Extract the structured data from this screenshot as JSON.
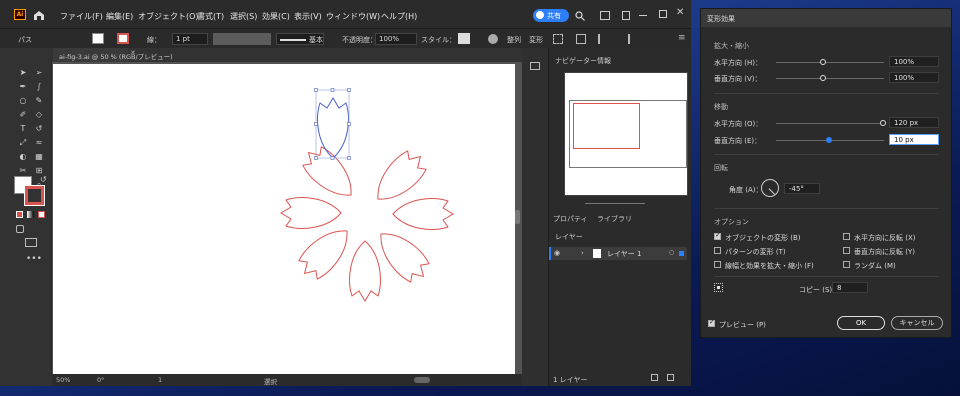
{
  "window": {
    "app_logo": "Ai",
    "doc_tab": "ai-fig-3.ai @ 50 % (RGB/プレビュー)",
    "share_label": "共有"
  },
  "menu": [
    "ファイル(F)",
    "編集(E)",
    "オブジェクト(O)",
    "書式(T)",
    "選択(S)",
    "効果(C)",
    "表示(V)",
    "ウィンドウ(W)",
    "ヘルプ(H)"
  ],
  "control_bar": {
    "object_type": "パス",
    "stroke_label": "線：",
    "stroke_weight": "1 pt",
    "brush_label": "基本",
    "opacity_label": "不透明度：",
    "opacity_value": "100%",
    "style_label": "スタイル：",
    "align_label": "整列",
    "transform_label": "変形"
  },
  "status_bar": {
    "zoom": "50%",
    "rotation": "0°",
    "artboard_num": "1",
    "tool_name": "選択"
  },
  "right_panel": {
    "tab_navigator": "ナビゲーター",
    "tab_info": "情報",
    "tab_properties": "プロパティ",
    "tab_libraries": "ライブラリ",
    "tab_layers": "レイヤー",
    "layer_name": "レイヤー 1",
    "layer_count": "1 レイヤー"
  },
  "dialog": {
    "title": "変形効果",
    "scale_section": "拡大・縮小",
    "scale_h_label": "水平方向 (H)：",
    "scale_h_value": "100%",
    "scale_v_label": "垂直方向 (V)：",
    "scale_v_value": "100%",
    "move_section": "移動",
    "move_h_label": "水平方向 (O)：",
    "move_h_value": "120 px",
    "move_v_label": "垂直方向 (E)：",
    "move_v_value": "10 px",
    "rotate_section": "回転",
    "angle_label": "角度 (A)：",
    "angle_value": "-45°",
    "options_section": "オプション",
    "opt_transform_objects": "オブジェクトの変形 (B)",
    "opt_transform_patterns": "パターンの変形 (T)",
    "opt_scale_strokes": "線幅と効果を拡大・縮小 (F)",
    "opt_reflect_x": "水平方向に反転 (X)",
    "opt_reflect_y": "垂直方向に反転 (Y)",
    "opt_random": "ランダム (M)",
    "copies_label": "コピー (S)",
    "copies_value": "8",
    "preview_label": "プレビュー (P)",
    "ok_label": "OK",
    "cancel_label": "キャンセル",
    "checked": {
      "opt_transform_objects": true,
      "opt_transform_patterns": false,
      "opt_scale_strokes": false,
      "opt_reflect_x": false,
      "opt_reflect_y": false,
      "opt_random": false,
      "preview": true
    }
  },
  "colors": {
    "petal_stroke": "#d9534f",
    "selected_petal": "#4a62c9",
    "accent_blue": "#2d7ff9",
    "ok_border": "#e0e0e0"
  }
}
